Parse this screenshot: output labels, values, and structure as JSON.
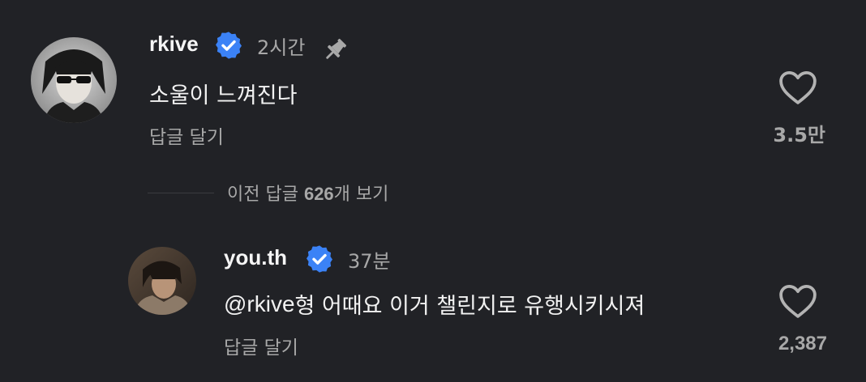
{
  "comments": [
    {
      "username": "rkive",
      "time": "2시간",
      "pinned": true,
      "text": "소울이 느껴진다",
      "reply_label": "답글 달기",
      "likes": "3.5만"
    },
    {
      "username": "you.th",
      "time": "37분",
      "mention": "@rkive",
      "text": " 형 어때요 이거 챌린지로 유행시키시져",
      "reply_label": "답글 달기",
      "likes": "2,387"
    }
  ],
  "view_replies": {
    "prefix": "이전 답글 ",
    "count": "626",
    "suffix": "개 보기"
  },
  "colors": {
    "background": "#212226",
    "verified_badge": "#3b82f6",
    "secondary_text": "#a8a8a8"
  },
  "icons": [
    "verified-icon",
    "pin-icon",
    "heart-icon",
    "threads-at-icon"
  ]
}
